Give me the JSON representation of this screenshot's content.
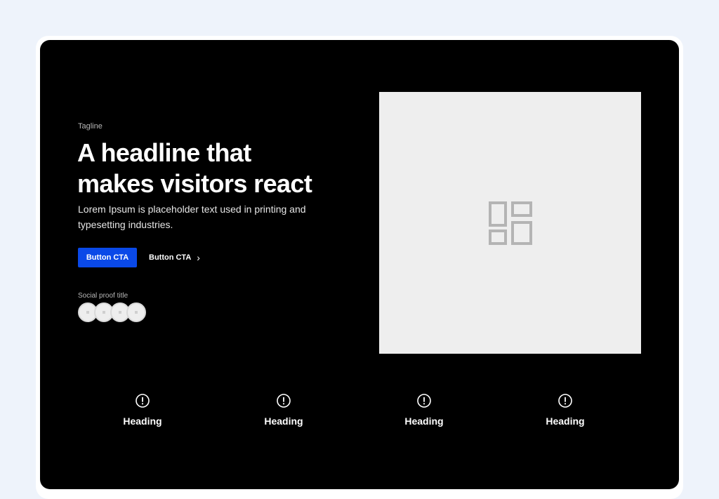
{
  "hero": {
    "tagline": "Tagline",
    "headline_lines": [
      "A headline that",
      "makes visitors react"
    ],
    "description_lines": [
      "Lorem Ipsum is placeholder text used in printing and",
      "typesetting industries."
    ],
    "primary_cta": "Button CTA",
    "secondary_cta": "Button CTA",
    "social_proof_title": "Social proof title",
    "accent_color": "#0a49e8"
  },
  "features": [
    {
      "heading": "Heading",
      "icon": "alert-circle-icon"
    },
    {
      "heading": "Heading",
      "icon": "alert-circle-icon"
    },
    {
      "heading": "Heading",
      "icon": "alert-circle-icon"
    },
    {
      "heading": "Heading",
      "icon": "alert-circle-icon"
    }
  ],
  "image": {
    "icon": "layout-grid-icon"
  }
}
